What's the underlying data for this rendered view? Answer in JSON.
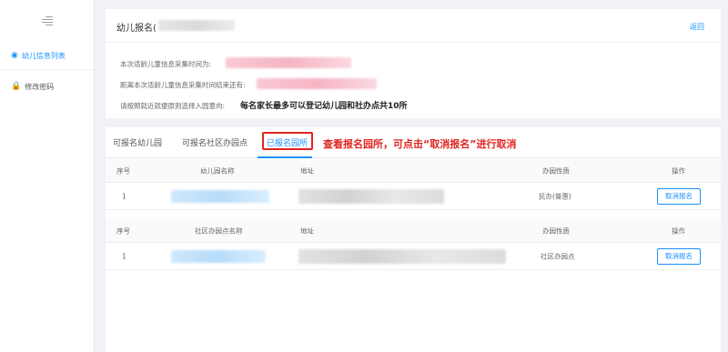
{
  "sidebar": {
    "items": [
      {
        "label": "幼儿信息列表",
        "icon": "user-icon",
        "active": true
      },
      {
        "label": "修改密码",
        "icon": "lock-icon",
        "active": false
      }
    ]
  },
  "header": {
    "title": "幼儿报名(",
    "back_label": "返回",
    "collect_time_label": "本次适龄儿童信息采集时间为:",
    "remaining_label": "距离本次适龄儿童信息采集时间结束还有:",
    "choose_label": "请按照就近就便原则选择入园意向:",
    "notice": "每名家长最多可以登记幼儿园和社办点共10所"
  },
  "tabs": [
    {
      "label": "可报名幼儿园"
    },
    {
      "label": "可报名社区办园点"
    },
    {
      "label": "已报名园所"
    }
  ],
  "annotation": "查看报名园所，可点击“取消报名”进行取消",
  "kindergarten_table": {
    "headers": [
      "序号",
      "幼儿园名称",
      "地址",
      "办园性质",
      "操作"
    ],
    "rows": [
      {
        "index": "1",
        "nature": "民办(普惠)",
        "action": "取消报名"
      }
    ]
  },
  "community_table": {
    "headers": [
      "序号",
      "社区办园点名称",
      "地址",
      "办园性质",
      "操作"
    ],
    "rows": [
      {
        "index": "1",
        "nature": "社区办园点",
        "action": "取消报名"
      }
    ]
  },
  "colors": {
    "accent": "#1890ff",
    "annotation": "#e0241f"
  }
}
